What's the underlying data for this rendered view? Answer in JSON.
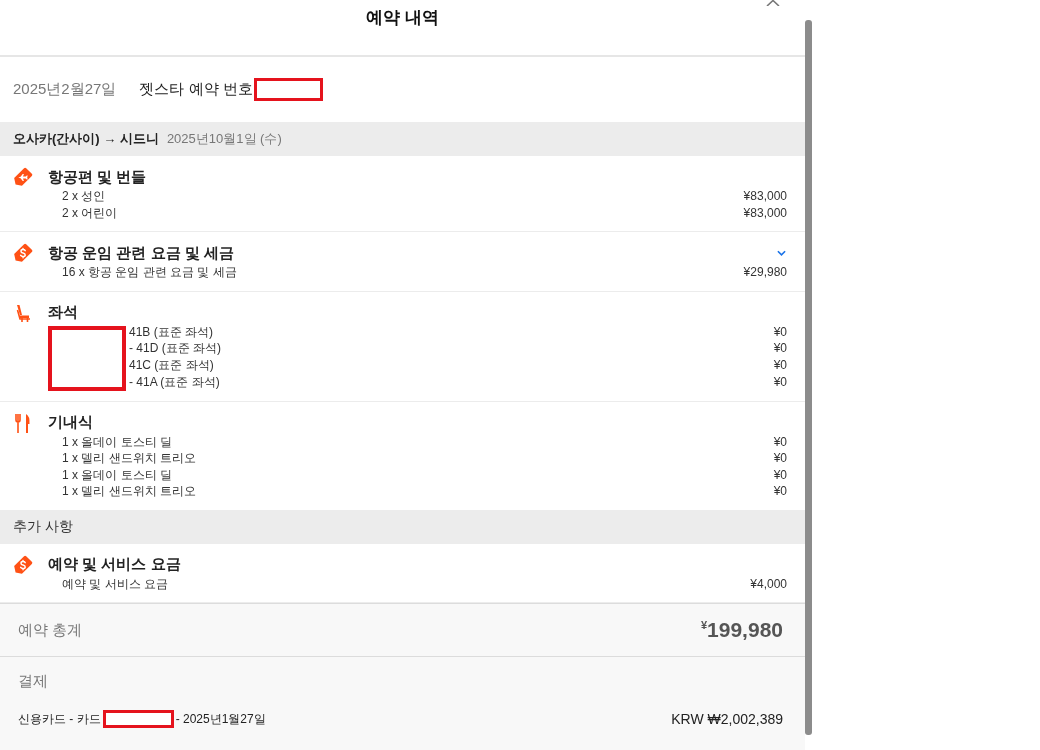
{
  "header": {
    "title": "예약 내역"
  },
  "booking": {
    "date": "2025년2월27일",
    "reference_label": "젯스타 예약 번호",
    "reference_redacted": true
  },
  "flight": {
    "route": "오사카(간사이) → 시드니",
    "date": "2025년10월1일 (수)"
  },
  "sections": [
    {
      "kind": "flight",
      "title": "항공편 및 번들",
      "redacted": false,
      "items": [
        {
          "text": "2 x 성인",
          "price": "¥83,000"
        },
        {
          "text": "2 x 어린이",
          "price": "¥83,000"
        }
      ]
    },
    {
      "kind": "fee",
      "title": "항공 운임 관련 요금 및 세금",
      "redacted": false,
      "expanded": false,
      "items": [
        {
          "text": "16 x 항공 운임 관련 요금 및 세금",
          "price": "¥29,980"
        }
      ]
    },
    {
      "kind": "seat",
      "title": "좌석",
      "redacted": true,
      "items": [
        {
          "text": "41B (표준 좌석)",
          "price": "¥0"
        },
        {
          "text": "- 41D (표준 좌석)",
          "price": "¥0"
        },
        {
          "text": "41C (표준 좌석)",
          "price": "¥0"
        },
        {
          "text": "- 41A (표준 좌석)",
          "price": "¥0"
        }
      ]
    },
    {
      "kind": "meal",
      "title": "기내식",
      "redacted": false,
      "items": [
        {
          "text": "1 x 올데이 토스티 딜",
          "price": "¥0"
        },
        {
          "text": "1 x 델리 샌드위치 트리오",
          "price": "¥0"
        },
        {
          "text": "1 x 올데이 토스티 딜",
          "price": "¥0"
        },
        {
          "text": "1 x 델리 샌드위치 트리오",
          "price": "¥0"
        }
      ]
    }
  ],
  "extras": {
    "heading": "추가 사항",
    "sections": [
      {
        "kind": "fee",
        "title": "예약 및 서비스 요금",
        "redacted": false,
        "items": [
          {
            "text": "예약 및 서비스 요금",
            "price": "¥4,000"
          }
        ]
      }
    ]
  },
  "total": {
    "label": "예약 총계",
    "amount": "$^{¥}$199,980"
  },
  "payment": {
    "heading": "결제",
    "method": "신용카드 - 카드",
    "card_redacted": true,
    "date": "- 2025년1월27일",
    "amount": "KRW ₩2,002,389"
  }
}
